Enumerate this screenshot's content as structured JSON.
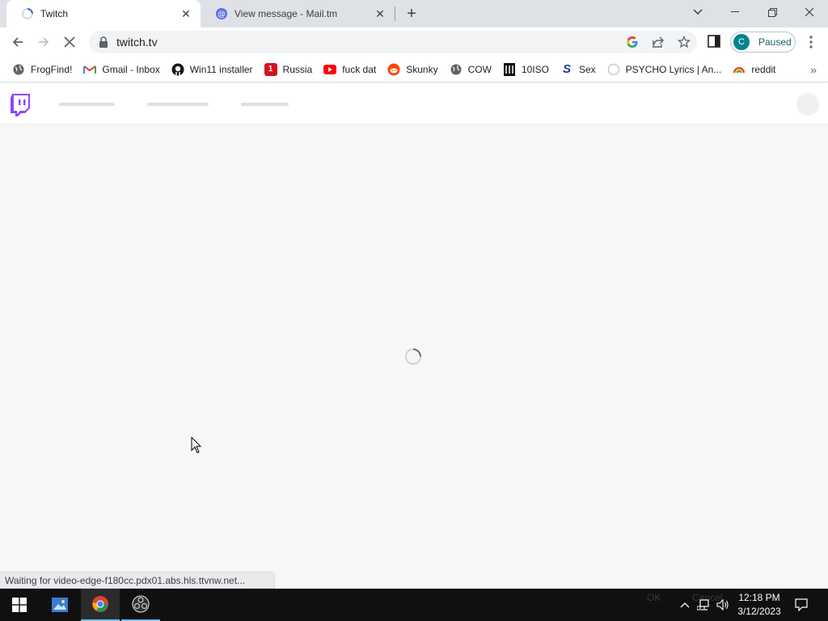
{
  "tabs": [
    {
      "title": "Twitch",
      "active": true,
      "favicon": "loading-icon"
    },
    {
      "title": "View message - Mail.tm",
      "active": false,
      "favicon": "mailtm-at-icon"
    }
  ],
  "toolbar": {
    "url": "twitch.tv",
    "profile_initial": "C",
    "profile_status": "Paused"
  },
  "bookmarks": [
    {
      "label": "FrogFind!",
      "icon": "globe-icon"
    },
    {
      "label": "Gmail - Inbox",
      "icon": "gmail-icon"
    },
    {
      "label": "Win11 installer",
      "icon": "github-icon"
    },
    {
      "label": "Russia",
      "icon": "red-square-icon"
    },
    {
      "label": "fuck dat",
      "icon": "youtube-icon"
    },
    {
      "label": "Skunky",
      "icon": "reddit-icon"
    },
    {
      "label": "COW",
      "icon": "globe-icon"
    },
    {
      "label": "10ISO",
      "icon": "building-icon"
    },
    {
      "label": "Sex",
      "icon": "s-logo-icon"
    },
    {
      "label": "PSYCHO Lyrics | An...",
      "icon": "circle-icon"
    },
    {
      "label": "reddit",
      "icon": "rainbow-icon"
    }
  ],
  "bookmarks_more": "»",
  "status_text": "Waiting for video-edge-f180cc.pdx01.abs.hls.ttvnw.net...",
  "taskbar": {
    "ghost_labels": [
      "OK",
      "Cancel"
    ],
    "clock_time": "12:18 PM",
    "clock_date": "3/12/2023"
  },
  "colors": {
    "twitch_purple": "#9146ff",
    "page_bg": "#f7f7f8",
    "taskbar_bg": "#101010",
    "profile_teal": "#00838f"
  }
}
